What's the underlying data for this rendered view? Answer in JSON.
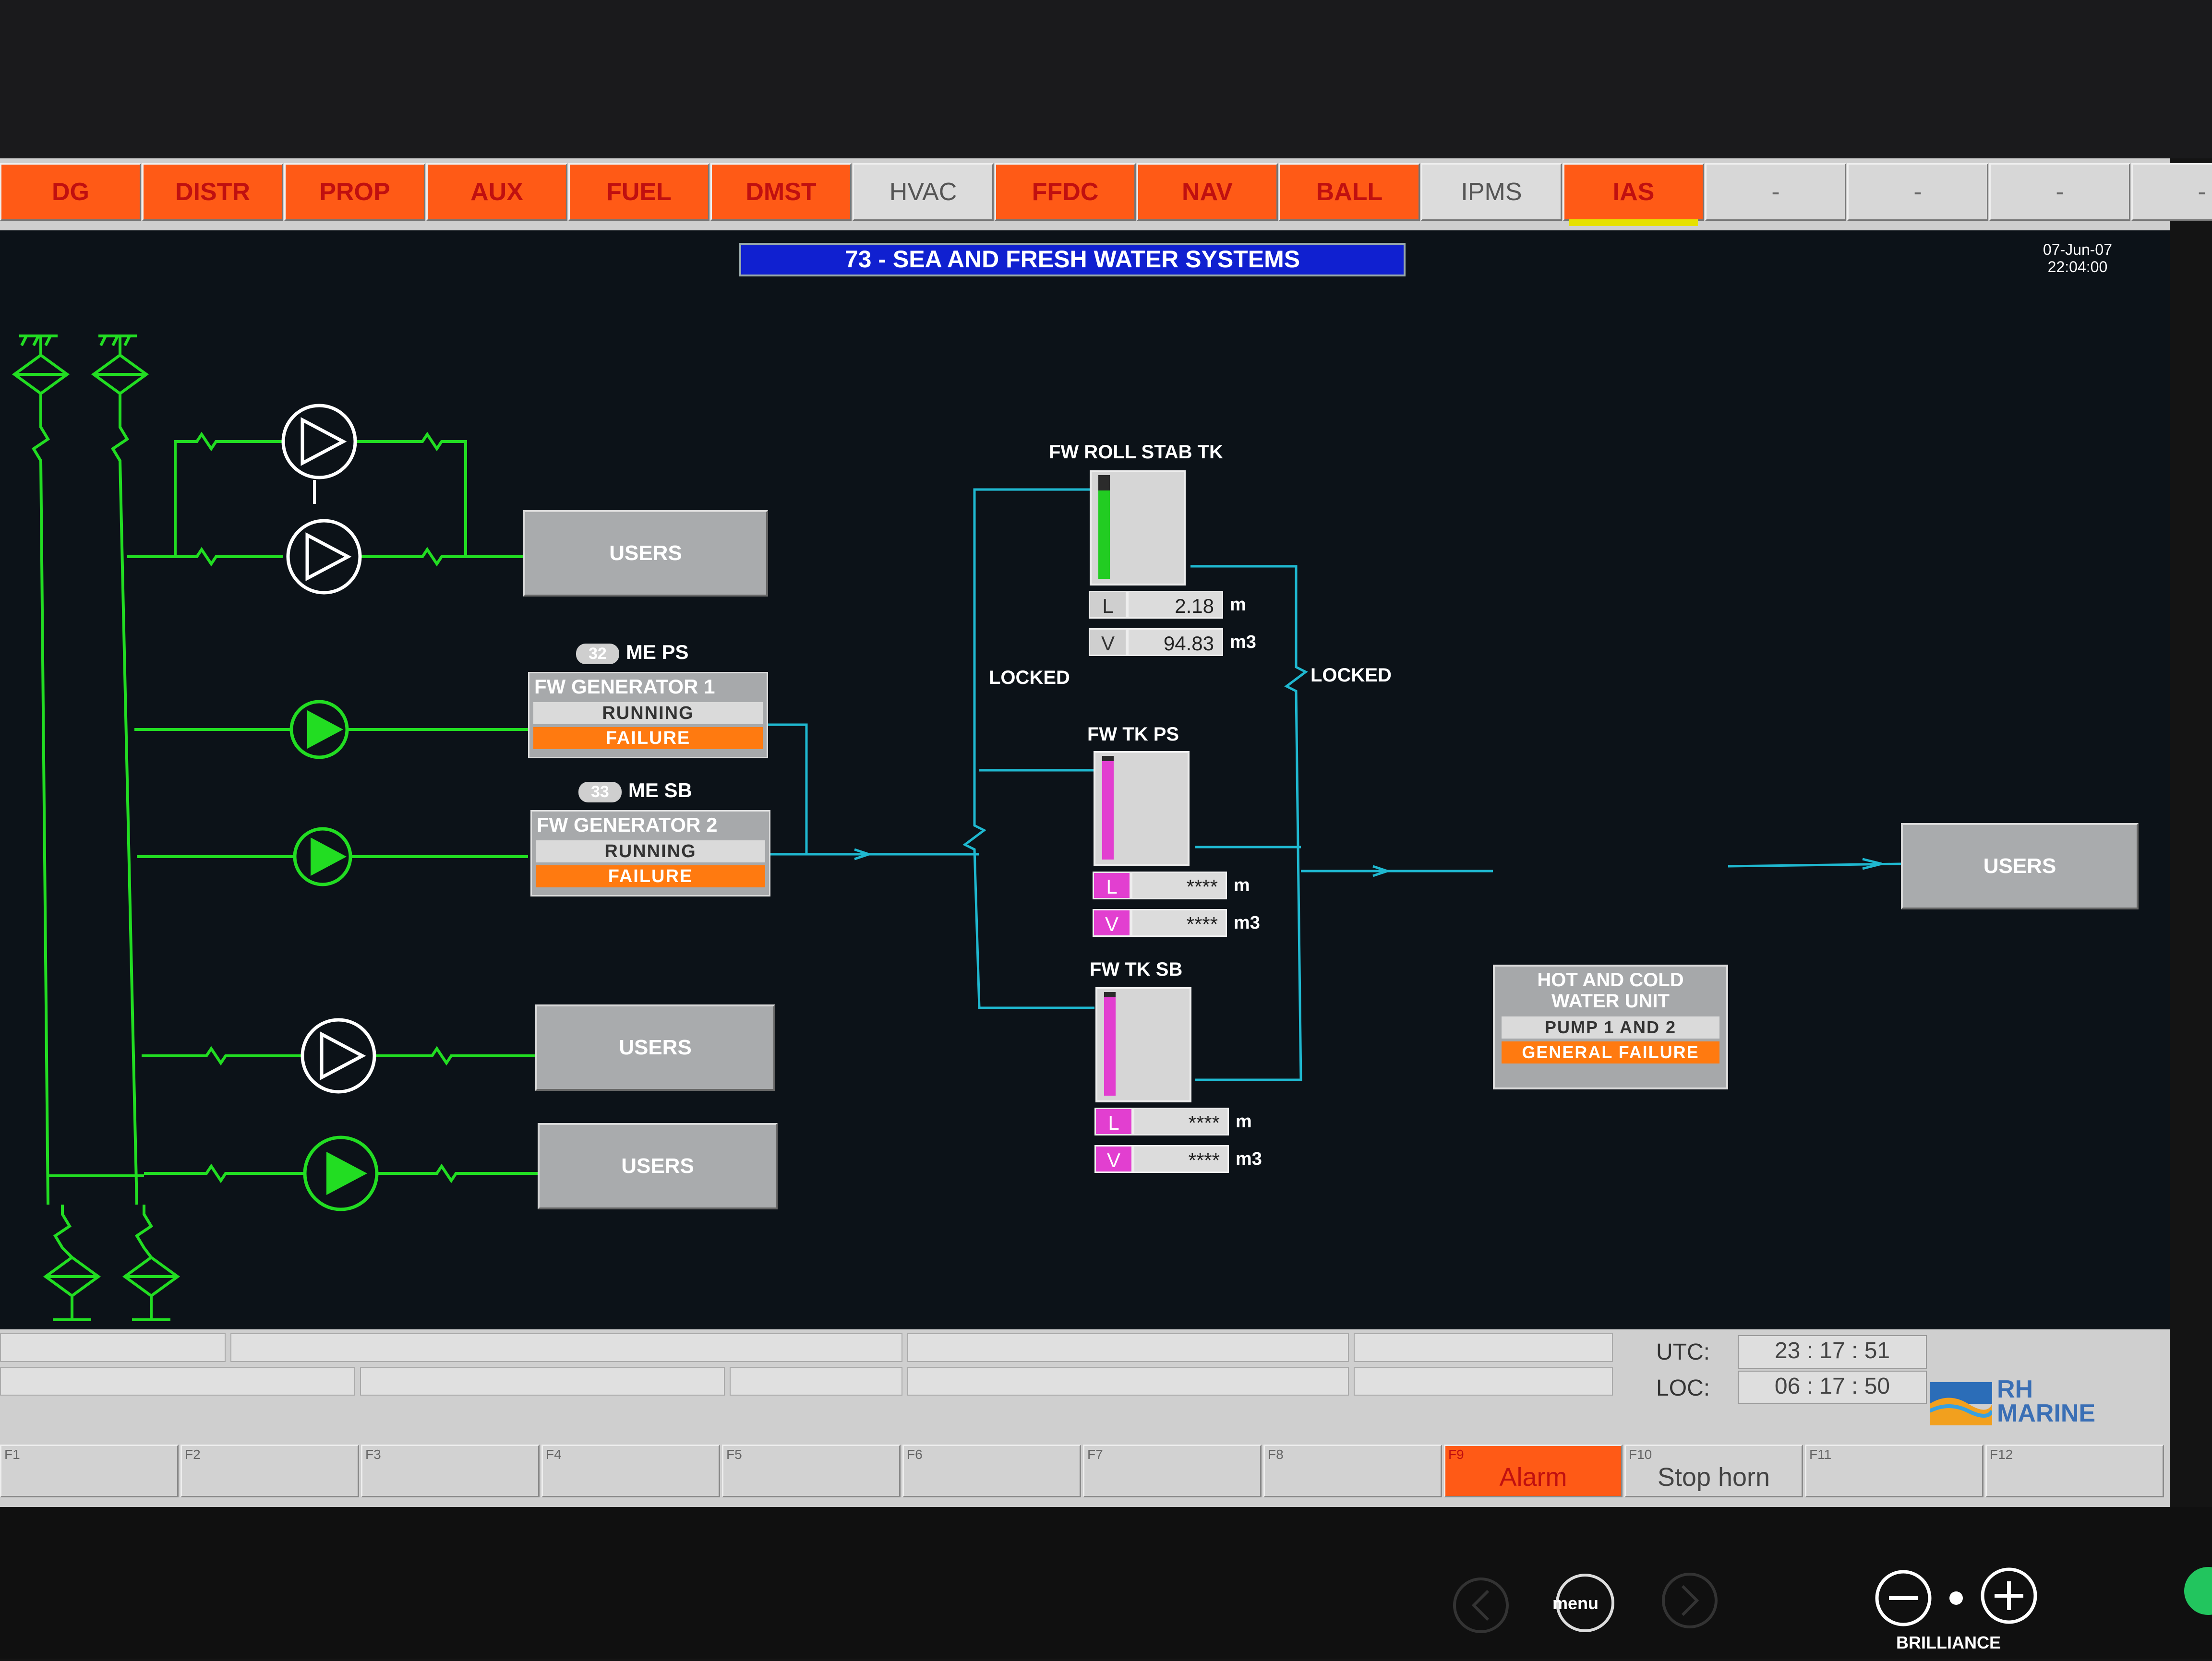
{
  "tabs": [
    {
      "label": "DG",
      "state": "alarm"
    },
    {
      "label": "DISTR",
      "state": "alarm"
    },
    {
      "label": "PROP",
      "state": "alarm"
    },
    {
      "label": "AUX",
      "state": "alarm"
    },
    {
      "label": "FUEL",
      "state": "alarm"
    },
    {
      "label": "DMST",
      "state": "alarm"
    },
    {
      "label": "HVAC",
      "state": "normal"
    },
    {
      "label": "FFDC",
      "state": "alarm"
    },
    {
      "label": "NAV",
      "state": "alarm"
    },
    {
      "label": "BALL",
      "state": "alarm"
    },
    {
      "label": "IPMS",
      "state": "normal"
    },
    {
      "label": "IAS",
      "state": "alarm",
      "active": true
    },
    {
      "label": "-",
      "state": "empty"
    },
    {
      "label": "-",
      "state": "empty"
    },
    {
      "label": "-",
      "state": "empty"
    },
    {
      "label": "-",
      "state": "empty"
    }
  ],
  "header": {
    "title": "73 - SEA AND FRESH WATER SYSTEMS",
    "date": "07-Jun-07",
    "time": "22:04:00"
  },
  "users_label": "USERS",
  "generators": [
    {
      "tag_num": "32",
      "tag": "ME PS",
      "name": "FW GENERATOR 1",
      "status": "RUNNING",
      "alarm": "FAILURE"
    },
    {
      "tag_num": "33",
      "tag": "ME SB",
      "name": "FW GENERATOR 2",
      "status": "RUNNING",
      "alarm": "FAILURE"
    }
  ],
  "locked_label": "LOCKED",
  "tanks": [
    {
      "title": "FW ROLL STAB TK",
      "level_fraction": 0.85,
      "l_key": "L",
      "l_val": "2.18",
      "l_unit": "m",
      "v_key": "V",
      "v_val": "94.83",
      "v_unit": "m3"
    },
    {
      "title": "FW TK PS",
      "level_fraction": 0.95,
      "l_key": "L",
      "l_val": "****",
      "l_unit": "m",
      "v_key": "V",
      "v_val": "****",
      "v_unit": "m3"
    },
    {
      "title": "FW TK SB",
      "level_fraction": 0.95,
      "l_key": "L",
      "l_val": "****",
      "l_unit": "m",
      "v_key": "V",
      "v_val": "****",
      "v_unit": "m3"
    }
  ],
  "hot_cold_unit": {
    "name_line1": "HOT AND COLD",
    "name_line2": "WATER UNIT",
    "status": "PUMP 1 AND 2",
    "alarm": "GENERAL FAILURE"
  },
  "clocks": {
    "utc_label": "UTC:",
    "utc": "23 : 17 : 51",
    "loc_label": "LOC:",
    "loc": "06 : 17 : 50"
  },
  "brand": {
    "line1": "RH",
    "line2": "MARINE"
  },
  "fkeys": [
    {
      "num": "F1",
      "label": ""
    },
    {
      "num": "F2",
      "label": ""
    },
    {
      "num": "F3",
      "label": ""
    },
    {
      "num": "F4",
      "label": ""
    },
    {
      "num": "F5",
      "label": ""
    },
    {
      "num": "F6",
      "label": ""
    },
    {
      "num": "F7",
      "label": ""
    },
    {
      "num": "F8",
      "label": ""
    },
    {
      "num": "F9",
      "label": "Alarm",
      "alarm": true
    },
    {
      "num": "F10",
      "label": "Stop horn"
    },
    {
      "num": "F11",
      "label": ""
    },
    {
      "num": "F12",
      "label": ""
    }
  ],
  "monitor": {
    "menu": "menu",
    "brilliance": "BRILLIANCE"
  },
  "colors": {
    "alarm": "#ff5a16",
    "pipe_sea": "#22dd22",
    "pipe_fresh": "#1fb8d0",
    "tank_pink": "#e23fd0",
    "tank_green": "#22cc22"
  }
}
